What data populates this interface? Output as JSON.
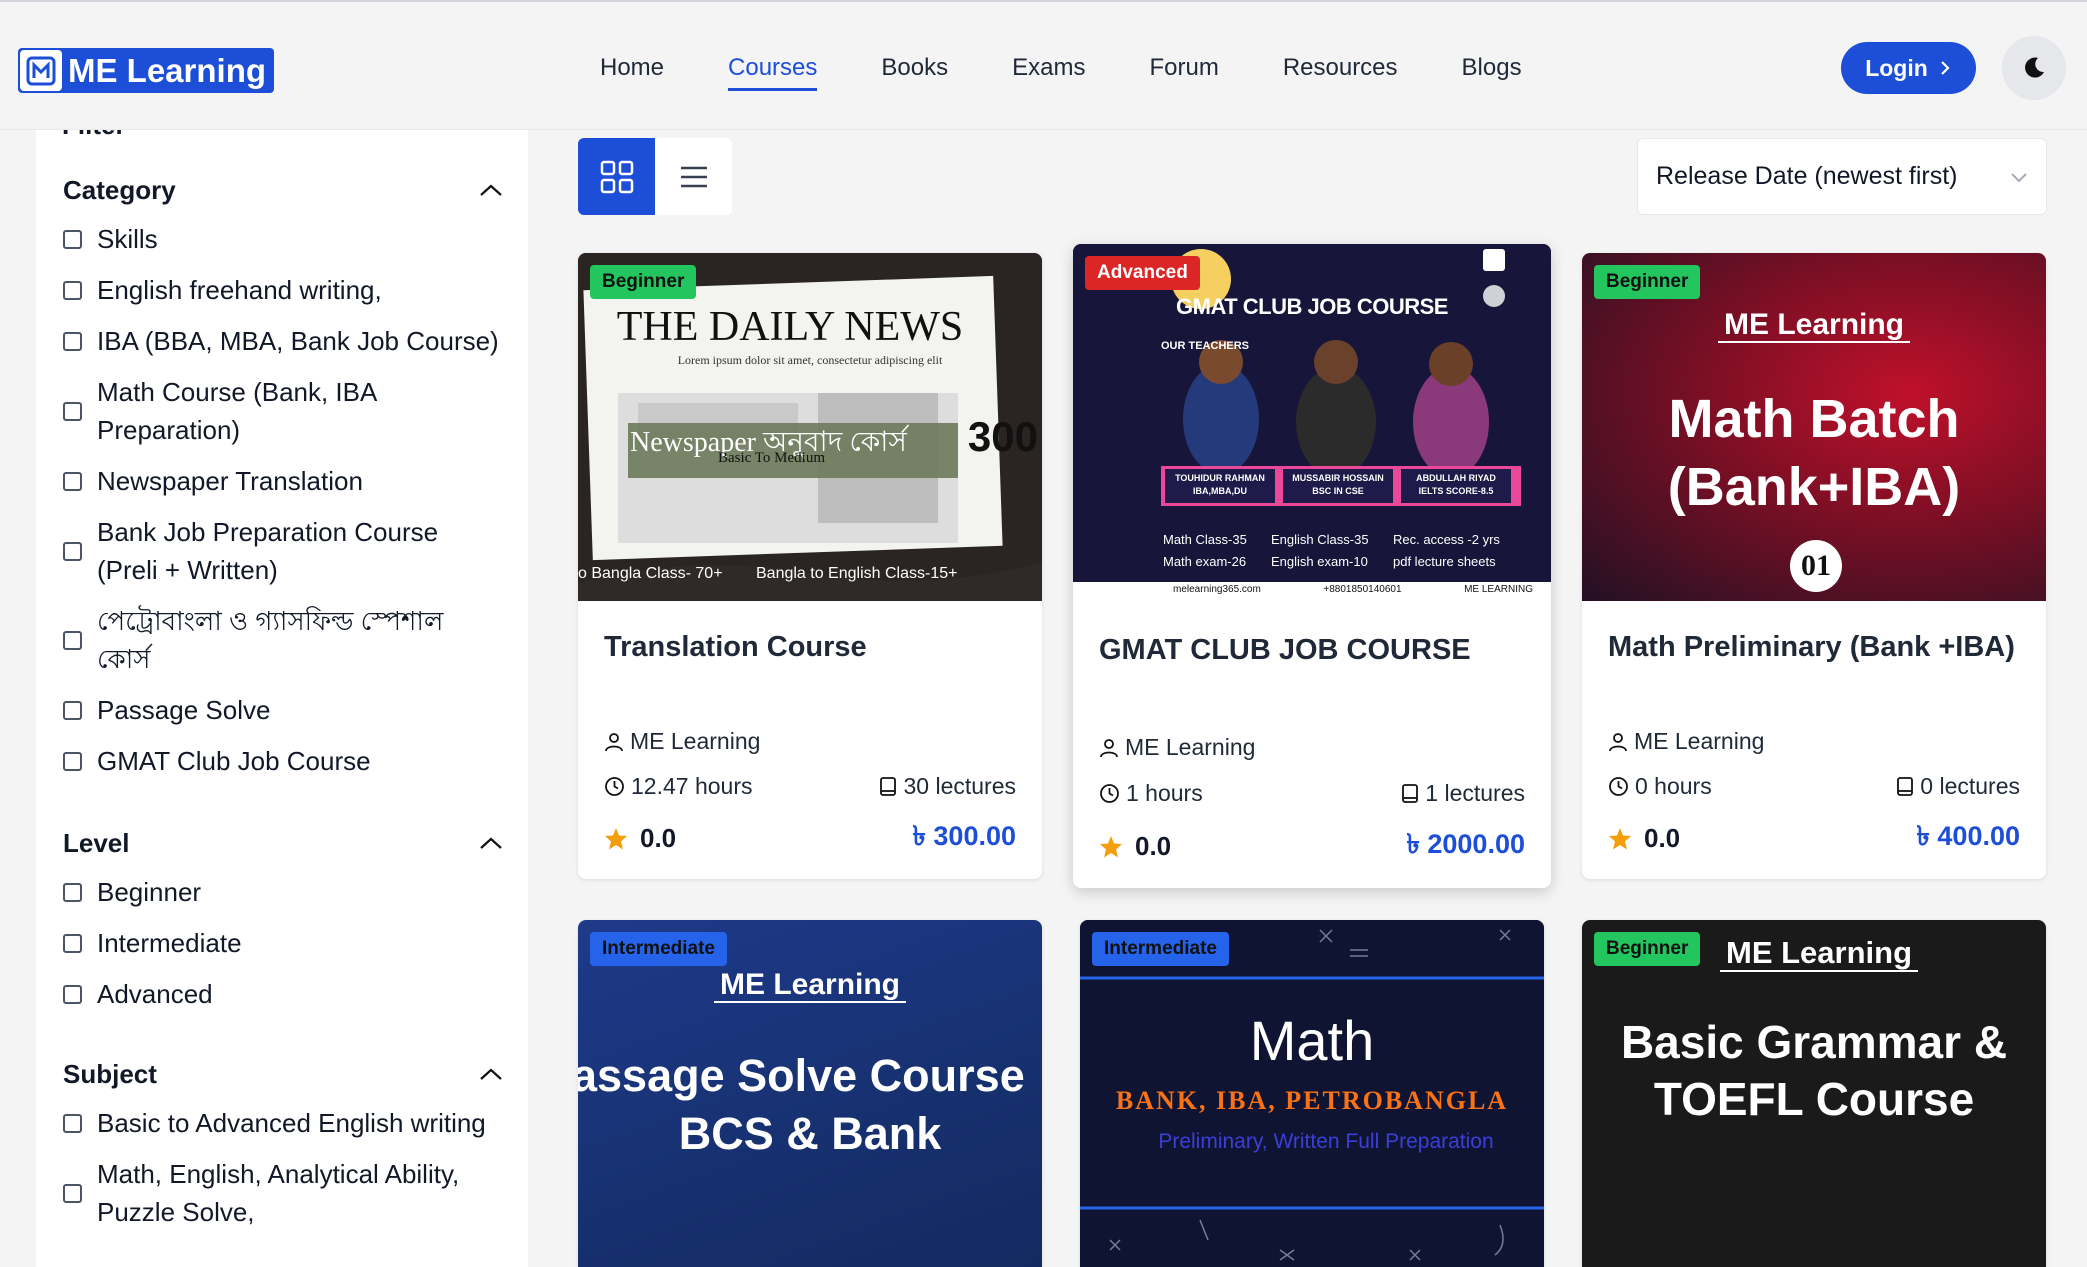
{
  "brand": {
    "name": "ME Learning",
    "color": "#1d4ed8"
  },
  "nav": {
    "items": [
      "Home",
      "Courses",
      "Books",
      "Exams",
      "Forum",
      "Resources",
      "Blogs"
    ],
    "active": "Courses"
  },
  "header": {
    "login_label": "Login",
    "login_icon": "chevron-right-icon",
    "theme_icon": "moon-icon"
  },
  "sidebar": {
    "filter_label": "Filter",
    "category": {
      "title": "Category",
      "options": [
        "Skills",
        "English freehand writing,",
        "IBA (BBA, MBA, Bank Job Course)",
        "Math Course (Bank, IBA Preparation)",
        "Newspaper Translation",
        "Bank Job Preparation Course (Preli + Written)",
        "পেট্রোবাংলা ও গ্যাসফিল্ড স্পেশাল কোর্স",
        "Passage Solve",
        "GMAT Club Job Course"
      ]
    },
    "level": {
      "title": "Level",
      "options": [
        "Beginner",
        "Intermediate",
        "Advanced"
      ]
    },
    "subject": {
      "title": "Subject",
      "options": [
        "Basic to Advanced English writing",
        "Math, English, Analytical Ability, Puzzle Solve,"
      ]
    }
  },
  "toolbar": {
    "grid_icon": "grid-view-icon",
    "list_icon": "list-view-icon",
    "sort_selected": "Release Date (newest first)"
  },
  "courses": [
    {
      "level": "Beginner",
      "title": "Translation Course",
      "author": "ME Learning",
      "hours": "12.47 hours",
      "lectures": "30 lectures",
      "rating": "0.0",
      "price": "৳ 300.00",
      "thumb": {
        "headline": "THE DAILY NEWS",
        "lorem": "Lorem ipsum dolor sit amet, consectetur adipiscing elit",
        "overlay": "Newspaper অনুবাদ কোর্স",
        "overlay_sub": "Basic To Medium",
        "count": "300",
        "foot_left": "o Bangla Class- 70+",
        "foot_right": "Bangla to English Class-15+"
      }
    },
    {
      "level": "Advanced",
      "title": "GMAT CLUB JOB COURSE",
      "author": "ME Learning",
      "hours": "1 hours",
      "lectures": "1 lectures",
      "rating": "0.0",
      "price": "৳ 2000.00",
      "thumb": {
        "headline": "GMAT CLUB JOB COURSE",
        "teachers_label": "OUR TEACHERS",
        "teachers": [
          {
            "name": "TOUHIDUR RAHMAN",
            "info": "IBA,MBA,DU"
          },
          {
            "name": "MUSSABIR HOSSAIN",
            "info": "BSC IN CSE"
          },
          {
            "name": "ABDULLAH RIYAD",
            "info": "IELTS SCORE-8.5"
          }
        ],
        "stats": [
          "Math Class-35",
          "English Class-35",
          "Rec. access -2 yrs",
          "Math exam-26",
          "English exam-10",
          "pdf lecture sheets"
        ],
        "footer": [
          "melearning365.com",
          "+8801850140601",
          "ME LEARNING"
        ]
      }
    },
    {
      "level": "Beginner",
      "title": "Math Preliminary (Bank +IBA)",
      "author": "ME Learning",
      "hours": "0 hours",
      "lectures": "0 lectures",
      "rating": "0.0",
      "price": "৳ 400.00",
      "thumb": {
        "brand": "ME Learning",
        "line1": "Math Batch",
        "line2": "(Bank+IBA)",
        "number": "01"
      }
    },
    {
      "level": "Intermediate",
      "thumb": {
        "brand": "ME Learning",
        "line1": "assage Solve Course",
        "line2": "BCS & Bank"
      }
    },
    {
      "level": "Intermediate",
      "thumb": {
        "line1": "Math",
        "line2": "BANK, IBA, PETROBANGLA",
        "line3": "Preliminary, Written Full Preparation"
      }
    },
    {
      "level": "Beginner",
      "thumb": {
        "brand": "ME Learning",
        "line1": "Basic Grammar &",
        "line2": "TOEFL Course"
      }
    }
  ]
}
